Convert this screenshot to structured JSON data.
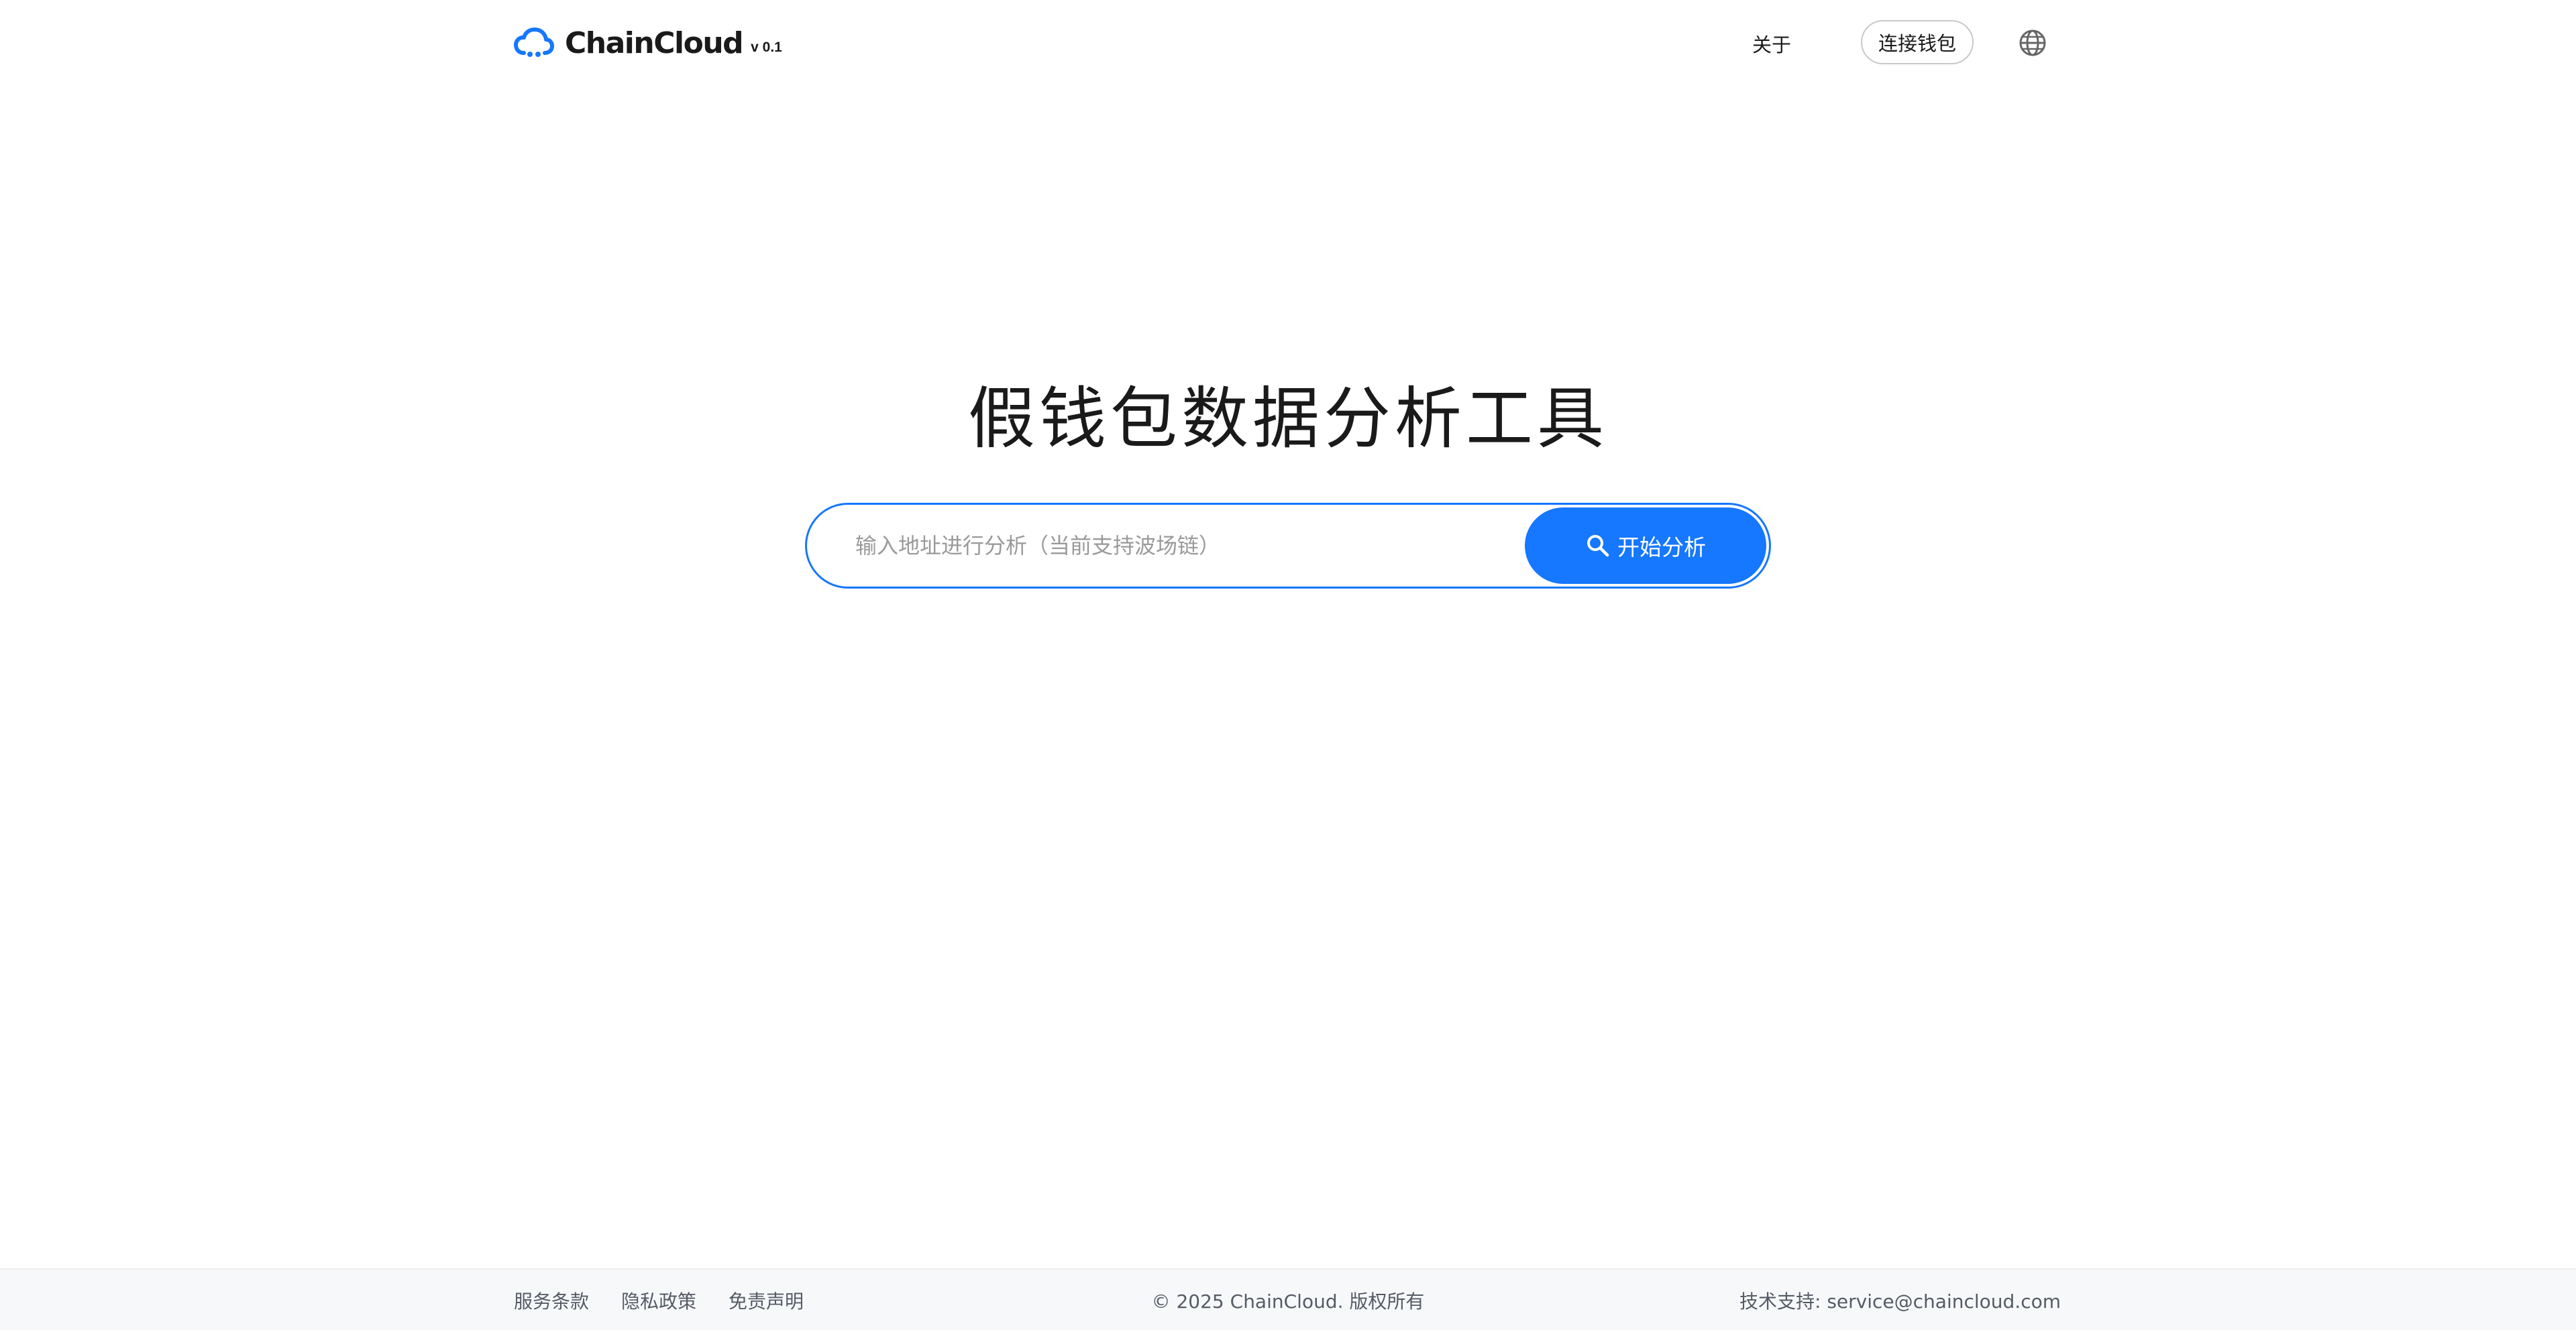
{
  "header": {
    "brand": "ChainCloud",
    "version": "v 0.1",
    "nav_about": "关于",
    "connect_wallet": "连接钱包",
    "language_icon": "globe-icon"
  },
  "main": {
    "title": "假钱包数据分析工具",
    "search": {
      "placeholder": "输入地址进行分析（当前支持波场链）",
      "value": "",
      "button_label": "开始分析",
      "button_icon": "search-icon"
    }
  },
  "footer": {
    "links": [
      "服务条款",
      "隐私政策",
      "免责声明"
    ],
    "copyright": "© 2025 ChainCloud. 版权所有",
    "support_label": "技术支持: ",
    "support_email": "service@chaincloud.com"
  },
  "colors": {
    "accent": "#1677ff",
    "text": "#1a1a1a",
    "footer_bg": "#f7f8fa",
    "footer_text": "#555b66"
  }
}
